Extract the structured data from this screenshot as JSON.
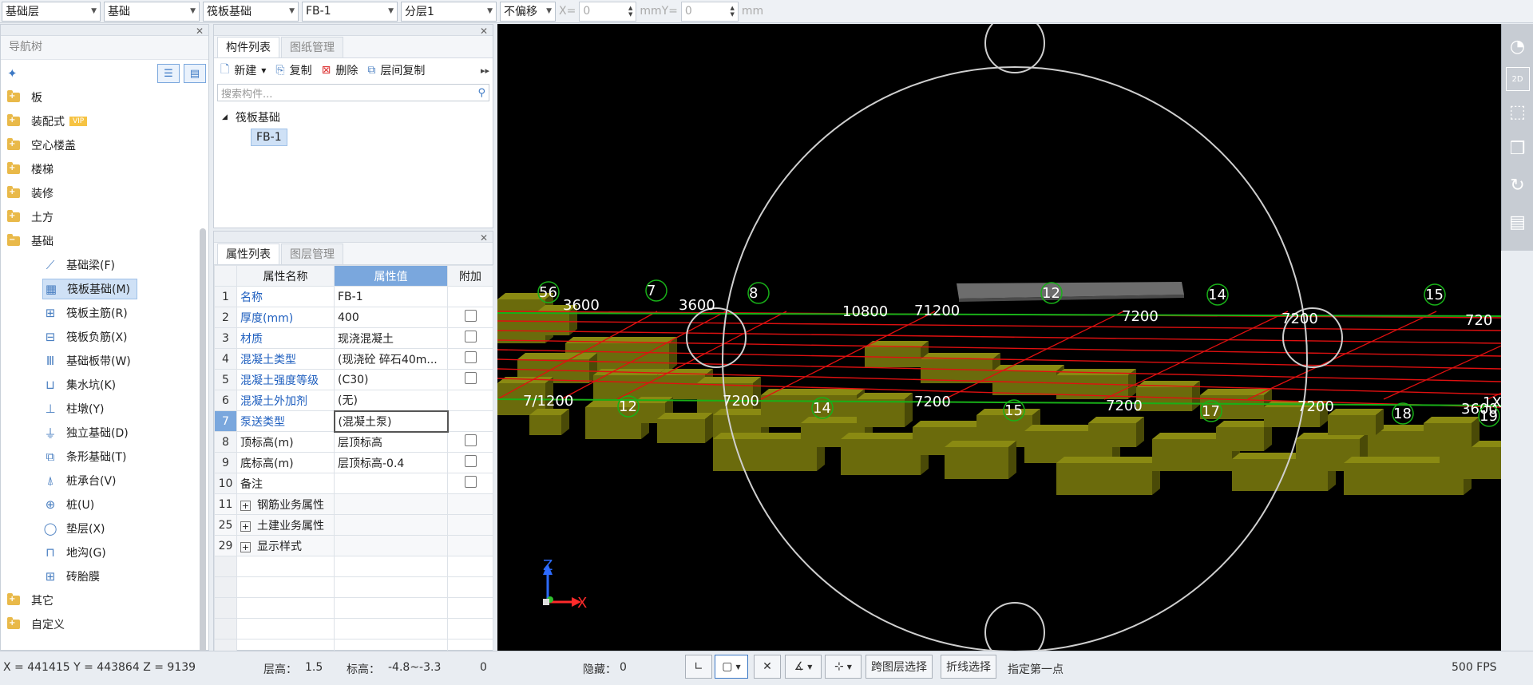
{
  "topbar": {
    "floor": "基础层",
    "category": "基础",
    "type": "筏板基础",
    "component": "FB-1",
    "layer": "分层1",
    "offset": "不偏移",
    "x_label": "X=",
    "x_value": "0",
    "y_label": "mmY=",
    "y_value": "0",
    "unit": "mm"
  },
  "nav": {
    "title": "导航树",
    "tree": [
      {
        "label": "板",
        "expanded": false
      },
      {
        "label": "装配式",
        "expanded": false,
        "badge": "VIP"
      },
      {
        "label": "空心楼盖",
        "expanded": false
      },
      {
        "label": "楼梯",
        "expanded": false
      },
      {
        "label": "装修",
        "expanded": false
      },
      {
        "label": "土方",
        "expanded": false
      },
      {
        "label": "基础",
        "expanded": true
      }
    ],
    "children": [
      {
        "label": "基础梁(F)",
        "icon": "beam-icon",
        "glyph": "⟋"
      },
      {
        "label": "筏板基础(M)",
        "icon": "raft-foundation-icon",
        "glyph": "▦",
        "selected": true
      },
      {
        "label": "筏板主筋(R)",
        "icon": "raft-main-rebar-icon",
        "glyph": "⊞"
      },
      {
        "label": "筏板负筋(X)",
        "icon": "raft-negative-rebar-icon",
        "glyph": "⊟"
      },
      {
        "label": "基础板带(W)",
        "icon": "foundation-strip-icon",
        "glyph": "Ⅲ"
      },
      {
        "label": "集水坑(K)",
        "icon": "sump-pit-icon",
        "glyph": "⊔"
      },
      {
        "label": "柱墩(Y)",
        "icon": "column-pier-icon",
        "glyph": "⊥"
      },
      {
        "label": "独立基础(D)",
        "icon": "isolated-footing-icon",
        "glyph": "⏚"
      },
      {
        "label": "条形基础(T)",
        "icon": "strip-footing-icon",
        "glyph": "⧉"
      },
      {
        "label": "桩承台(V)",
        "icon": "pile-cap-icon",
        "glyph": "⍋"
      },
      {
        "label": "桩(U)",
        "icon": "pile-icon",
        "glyph": "⊕"
      },
      {
        "label": "垫层(X)",
        "icon": "cushion-layer-icon",
        "glyph": "◯"
      },
      {
        "label": "地沟(G)",
        "icon": "trench-icon",
        "glyph": "⊓"
      },
      {
        "label": "砖胎膜",
        "icon": "brick-mold-icon",
        "glyph": "⊞"
      }
    ],
    "tree_after": [
      {
        "label": "其它",
        "expanded": false
      },
      {
        "label": "自定义",
        "expanded": false
      }
    ]
  },
  "complist": {
    "tabs": [
      "构件列表",
      "图纸管理"
    ],
    "new_label": "新建",
    "copy_label": "复制",
    "delete_label": "删除",
    "floor_copy_label": "层间复制",
    "search_placeholder": "搜索构件...",
    "group": "筏板基础",
    "item": "FB-1"
  },
  "proplist": {
    "tabs": [
      "属性列表",
      "图层管理"
    ],
    "headers": [
      "属性名称",
      "属性值",
      "附加"
    ],
    "rows": [
      {
        "num": "1",
        "name": "名称",
        "value": "FB-1",
        "blue": true,
        "chk": false
      },
      {
        "num": "2",
        "name": "厚度(mm)",
        "value": "400",
        "blue": true,
        "chk": true
      },
      {
        "num": "3",
        "name": "材质",
        "value": "现浇混凝土",
        "blue": true,
        "chk": true
      },
      {
        "num": "4",
        "name": "混凝土类型",
        "value": "(现浇砼 碎石40m...",
        "blue": true,
        "chk": true
      },
      {
        "num": "5",
        "name": "混凝土强度等级",
        "value": "(C30)",
        "blue": true,
        "chk": true
      },
      {
        "num": "6",
        "name": "混凝土外加剂",
        "value": "(无)",
        "blue": true,
        "chk": false
      },
      {
        "num": "7",
        "name": "泵送类型",
        "value": "(混凝土泵)",
        "blue": true,
        "chk": false,
        "selected": true
      },
      {
        "num": "8",
        "name": "顶标高(m)",
        "value": "层顶标高",
        "blue": false,
        "chk": true
      },
      {
        "num": "9",
        "name": "底标高(m)",
        "value": "层顶标高-0.4",
        "blue": false,
        "chk": true
      },
      {
        "num": "10",
        "name": "备注",
        "value": "",
        "blue": false,
        "chk": true
      }
    ],
    "groups": [
      {
        "num": "11",
        "name": "钢筋业务属性"
      },
      {
        "num": "25",
        "name": "土建业务属性"
      },
      {
        "num": "29",
        "name": "显示样式"
      }
    ]
  },
  "viewport": {
    "top_labels": [
      "56",
      "3600",
      "7",
      "3600",
      "8",
      "10800",
      "71200",
      "12",
      "7200",
      "14",
      "7200",
      "15",
      "720"
    ],
    "bottom_labels": [
      "7/1200",
      "12",
      "7200",
      "14",
      "7200",
      "15",
      "7200",
      "17",
      "7200",
      "18",
      "3600",
      "19",
      "1X"
    ],
    "axis_z": "Z",
    "axis_x": "X"
  },
  "statusbar": {
    "coords": "X = 441415 Y = 443864 Z = 9139",
    "floor_height_label": "层高：",
    "floor_height": "1.5",
    "elevation_label": "标高：",
    "elevation": "-4.8~-3.3",
    "count": "0",
    "hidden_label": "隐藏：",
    "hidden": "0",
    "cross_layer_btn": "跨图层选择",
    "polyline_btn": "折线选择",
    "hint": "指定第一点",
    "fps": "500 FPS"
  }
}
